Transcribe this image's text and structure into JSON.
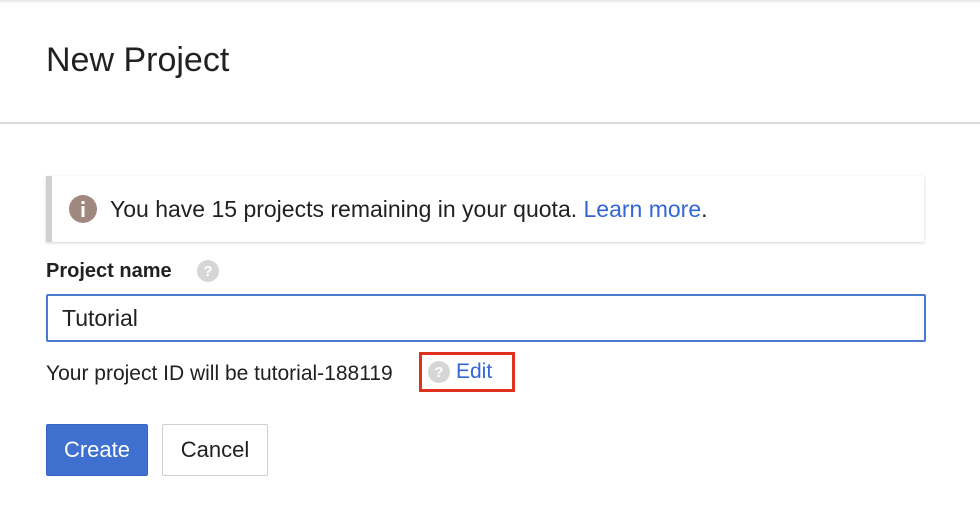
{
  "header": {
    "title": "New Project"
  },
  "quota_banner": {
    "icon": "info-icon",
    "text": "You have 15 projects remaining in your quota.",
    "link": "Learn more",
    "suffix": "."
  },
  "project_name": {
    "label": "Project name",
    "help_icon": "help-icon",
    "value": "Tutorial"
  },
  "project_id": {
    "text": "Your project ID will be tutorial-188119",
    "help_icon": "help-icon",
    "edit_label": "Edit"
  },
  "buttons": {
    "create": "Create",
    "cancel": "Cancel"
  },
  "colors": {
    "accent": "#3f6fcf",
    "link": "#3367d6",
    "highlight": "#e0301e"
  }
}
